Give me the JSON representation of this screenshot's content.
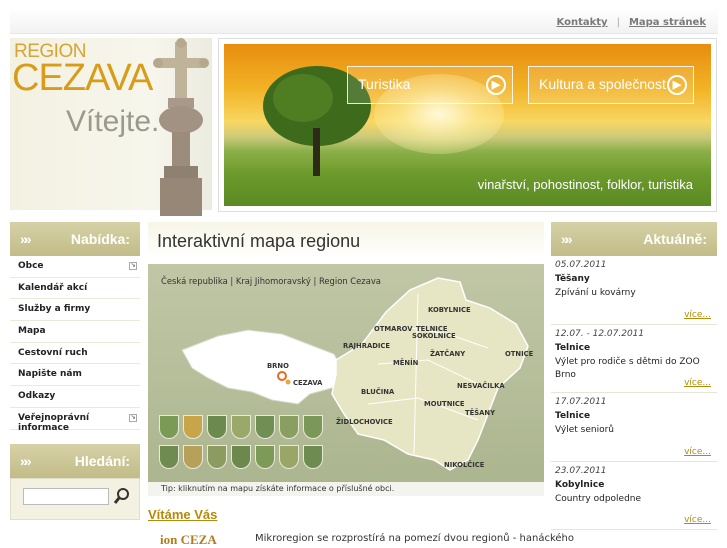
{
  "top_links": [
    "Kontakty",
    "Mapa stránek"
  ],
  "top_separator": "|",
  "brand": {
    "region": "REGION",
    "name": "CEZAVA",
    "welcome": "Vítejte."
  },
  "banner": {
    "links": [
      "Turistika",
      "Kultura a společnost"
    ],
    "tagline": "vinařství, pohostinost, folklor, turistika"
  },
  "sidebar": {
    "menu_title": "Nabídka:",
    "items": [
      "Obce",
      "Kalendář akcí",
      "Služby a firmy",
      "Mapa",
      "Cestovní ruch",
      "Napište nám",
      "Odkazy",
      "Veřejnoprávní informace"
    ],
    "search_title": "Hledání:"
  },
  "main": {
    "title": "Interaktivní mapa regionu",
    "breadcrumb": "Česká republika | Kraj Jihomoravský | Region Cezava",
    "tip": "Tip: kliknutím na mapu získáte informace o příslušné obci.",
    "city_labels": [
      "BRNO",
      "CEZAVA"
    ],
    "towns": [
      "KOBYLNICE",
      "SOKOLNICE",
      "OTMAROV",
      "TELNICE",
      "RAJHRADICE",
      "MĚNÍN",
      "ŽATČANY",
      "OTNICE",
      "BLUČINA",
      "NESVAČILKA",
      "MOUTNICE",
      "ŽIDLOCHOVICE",
      "TĚŠANY",
      "NIKOLČICE"
    ],
    "welcome_heading": "Vítáme Vás",
    "logo_fragment": "ion CEZA",
    "teaser": "Mikroregion se rozprostírá na pomezí dvou regionů - hanáckého"
  },
  "news": {
    "title": "Aktuálně:",
    "items": [
      {
        "date": "05.07.2011",
        "place": "Těšany",
        "text": "Zpívání u kovárny",
        "more": "více..."
      },
      {
        "date": "12.07. - 12.07.2011",
        "place": "Telnice",
        "text": "Výlet pro rodiče s dětmi do ZOO Brno",
        "more": "více..."
      },
      {
        "date": "17.07.2011",
        "place": "Telnice",
        "text": "Výlet seniorů",
        "more": "více..."
      },
      {
        "date": "23.07.2011",
        "place": "Kobylnice",
        "text": "Country odpoledne",
        "more": "více..."
      }
    ]
  }
}
